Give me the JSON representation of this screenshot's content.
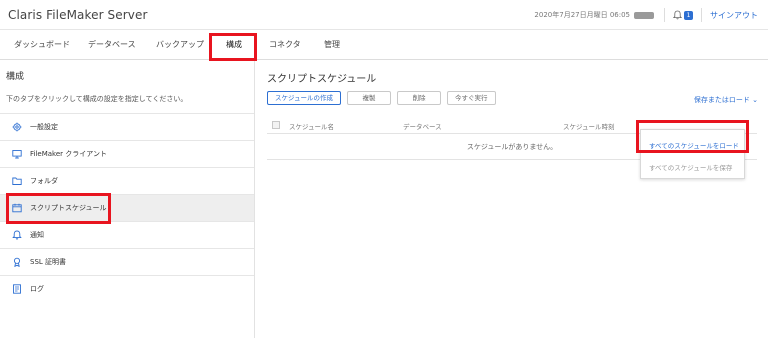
{
  "header": {
    "app_title": "Claris FileMaker Server",
    "datetime": "2020年7月27日月曜日 06:05",
    "status_pill": "",
    "notification_count": "1",
    "signin_label": "サインアウト",
    "accent_color": "#2d6fd2"
  },
  "tabs": [
    {
      "label": "ダッシュボード"
    },
    {
      "label": "データベース"
    },
    {
      "label": "バックアップ"
    },
    {
      "label": "構成"
    },
    {
      "label": "コネクタ"
    },
    {
      "label": "管理"
    }
  ],
  "sidebar": {
    "title": "構成",
    "description": "下のタブをクリックして構成の設定を指定してください。",
    "items": [
      {
        "label": "一般設定",
        "icon": "gear-icon"
      },
      {
        "label": "FileMaker クライアント",
        "icon": "monitor-icon"
      },
      {
        "label": "フォルダ",
        "icon": "folder-icon"
      },
      {
        "label": "スクリプトスケジュール",
        "icon": "calendar-icon"
      },
      {
        "label": "通知",
        "icon": "bell-icon"
      },
      {
        "label": "SSL 証明書",
        "icon": "certificate-icon"
      },
      {
        "label": "ログ",
        "icon": "log-icon"
      }
    ]
  },
  "main": {
    "title": "スクリプトスケジュール",
    "buttons": {
      "create": "スケジュールの作成",
      "duplicate": "複製",
      "delete": "削除",
      "run_now": "今すぐ実行"
    },
    "save_load": "保存またはロード ⌄",
    "table": {
      "columns": [
        "スケジュール名",
        "データベース",
        "スケジュール時刻"
      ],
      "empty_message": "スケジュールがありません。"
    },
    "dropdown": {
      "load_all": "すべてのスケジュールをロード",
      "save_all": "すべてのスケジュールを保存"
    }
  },
  "highlight_color": "#e8141f"
}
